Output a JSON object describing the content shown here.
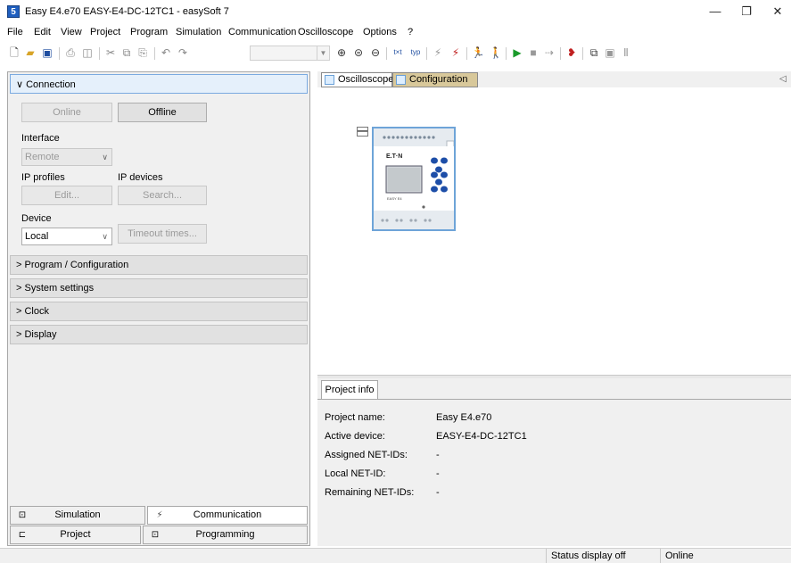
{
  "window": {
    "title": "Easy E4.e70 EASY-E4-DC-12TC1 - easySoft 7",
    "app_icon": "5",
    "controls": {
      "minimize": "—",
      "maximize": "❐",
      "close": "✕"
    }
  },
  "menu": {
    "items": [
      "File",
      "Edit",
      "View",
      "Project",
      "Program",
      "Simulation",
      "Communication",
      "Oscilloscope",
      "Options",
      "?"
    ]
  },
  "toolbar": {
    "icons": [
      "new-file-icon",
      "open-folder-icon",
      "save-icon",
      "print-icon",
      "print-preview-icon",
      "cut-icon",
      "copy-icon",
      "paste-icon",
      "undo-icon",
      "redo-icon",
      "zoom-in-icon",
      "zoom-reset-icon",
      "zoom-out-icon",
      "text-layout-icon",
      "type-layout-icon",
      "disconnect-icon",
      "connect-icon",
      "run-person-icon",
      "stop-person-icon",
      "play-icon",
      "stop-icon",
      "step-icon",
      "breakpoint-icon",
      "trend-icon",
      "record-icon",
      "pause-icon"
    ]
  },
  "left_panel": {
    "connection": {
      "header": "∨ Connection",
      "online_button": "Online",
      "offline_button": "Offline",
      "interface_label": "Interface",
      "interface_value": "Remote",
      "ip_profiles_label": "IP profiles",
      "ip_devices_label": "IP devices",
      "edit_button": "Edit...",
      "search_button": "Search...",
      "device_label": "Device",
      "device_value": "Local",
      "timeout_button": "Timeout times..."
    },
    "sections": [
      "> Program / Configuration",
      "> System settings",
      "> Clock",
      "> Display"
    ],
    "bottom_tabs": {
      "simulation": "Simulation",
      "communication": "Communication",
      "project": "Project",
      "programming": "Programming"
    }
  },
  "right_panel": {
    "tabs": [
      "Oscilloscope",
      "Configuration"
    ],
    "scroll_arrow": "◁",
    "device": {
      "brand": "E.T·N",
      "model": "EASY E4",
      "collapse": "—"
    },
    "project_info": {
      "tab": "Project info",
      "rows": [
        {
          "key": "Project name:",
          "value": "Easy E4.e70"
        },
        {
          "key": "Active device:",
          "value": "EASY-E4-DC-12TC1"
        },
        {
          "key": "Assigned NET-IDs:",
          "value": "-"
        },
        {
          "key": "Local NET-ID:",
          "value": "-"
        },
        {
          "key": "Remaining NET-IDs:",
          "value": "-"
        }
      ]
    }
  },
  "status_bar": {
    "display": "Status display off",
    "connection": "Online"
  }
}
